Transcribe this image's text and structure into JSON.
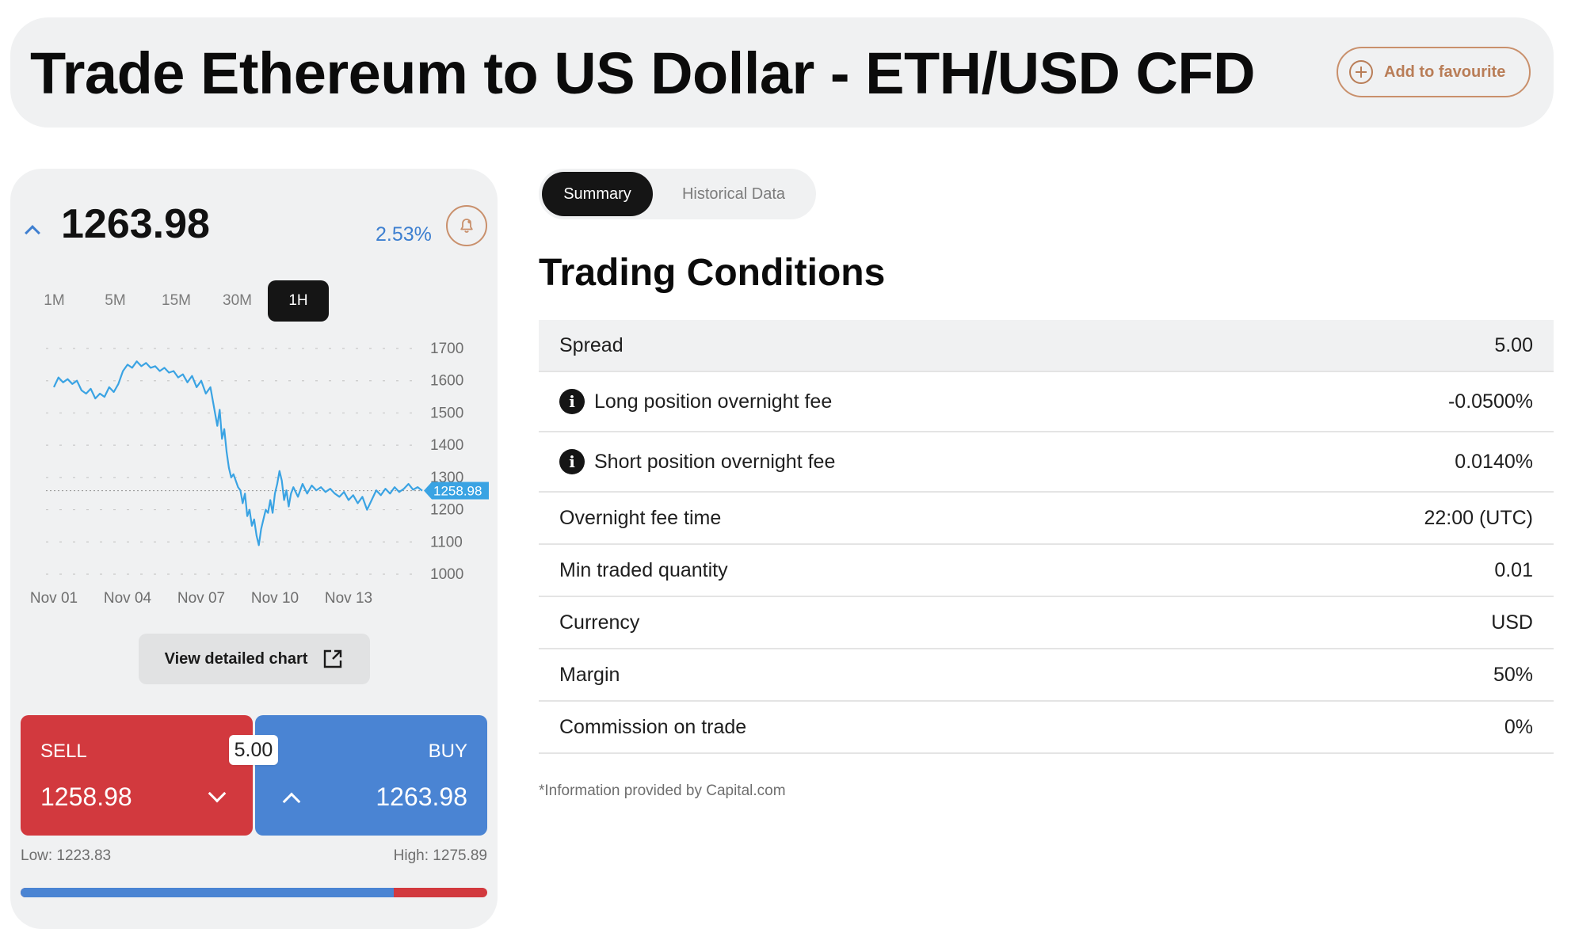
{
  "header": {
    "title": "Trade Ethereum to US Dollar - ETH/USD CFD",
    "favourite_label": "Add to favourite"
  },
  "quote": {
    "price": "1263.98",
    "change_pct": "2.53%",
    "timeframes": [
      "1M",
      "5M",
      "15M",
      "30M",
      "1H"
    ],
    "active_timeframe": "1H"
  },
  "chart_data": {
    "type": "line",
    "x_ticks": [
      "Nov 01",
      "Nov 04",
      "Nov 07",
      "Nov 10",
      "Nov 13"
    ],
    "y_ticks": [
      1700,
      1600,
      1500,
      1400,
      1300,
      1200,
      1100,
      1000
    ],
    "ylim": [
      1000,
      1700
    ],
    "current_marker": "1258.98",
    "grid": true,
    "series": [
      {
        "color": "#3aa3e3",
        "points": [
          [
            0.0,
            1580
          ],
          [
            0.1,
            1610
          ],
          [
            0.2,
            1595
          ],
          [
            0.3,
            1605
          ],
          [
            0.4,
            1590
          ],
          [
            0.5,
            1600
          ],
          [
            0.6,
            1570
          ],
          [
            0.7,
            1560
          ],
          [
            0.8,
            1575
          ],
          [
            0.9,
            1545
          ],
          [
            1.0,
            1560
          ],
          [
            1.1,
            1550
          ],
          [
            1.2,
            1580
          ],
          [
            1.3,
            1565
          ],
          [
            1.4,
            1590
          ],
          [
            1.5,
            1630
          ],
          [
            1.6,
            1650
          ],
          [
            1.7,
            1640
          ],
          [
            1.8,
            1660
          ],
          [
            1.9,
            1645
          ],
          [
            2.0,
            1655
          ],
          [
            2.1,
            1640
          ],
          [
            2.2,
            1645
          ],
          [
            2.3,
            1630
          ],
          [
            2.4,
            1640
          ],
          [
            2.5,
            1625
          ],
          [
            2.6,
            1630
          ],
          [
            2.7,
            1610
          ],
          [
            2.8,
            1620
          ],
          [
            2.9,
            1595
          ],
          [
            3.0,
            1615
          ],
          [
            3.1,
            1580
          ],
          [
            3.2,
            1600
          ],
          [
            3.3,
            1560
          ],
          [
            3.4,
            1580
          ],
          [
            3.5,
            1500
          ],
          [
            3.55,
            1460
          ],
          [
            3.6,
            1510
          ],
          [
            3.65,
            1420
          ],
          [
            3.7,
            1450
          ],
          [
            3.75,
            1380
          ],
          [
            3.8,
            1330
          ],
          [
            3.85,
            1300
          ],
          [
            3.9,
            1310
          ],
          [
            4.0,
            1270
          ],
          [
            4.05,
            1260
          ],
          [
            4.1,
            1220
          ],
          [
            4.15,
            1250
          ],
          [
            4.2,
            1180
          ],
          [
            4.25,
            1200
          ],
          [
            4.3,
            1150
          ],
          [
            4.35,
            1170
          ],
          [
            4.4,
            1120
          ],
          [
            4.45,
            1090
          ],
          [
            4.5,
            1140
          ],
          [
            4.55,
            1170
          ],
          [
            4.6,
            1200
          ],
          [
            4.65,
            1190
          ],
          [
            4.7,
            1230
          ],
          [
            4.75,
            1190
          ],
          [
            4.8,
            1250
          ],
          [
            4.85,
            1280
          ],
          [
            4.9,
            1320
          ],
          [
            4.95,
            1290
          ],
          [
            5.0,
            1230
          ],
          [
            5.05,
            1260
          ],
          [
            5.1,
            1210
          ],
          [
            5.15,
            1250
          ],
          [
            5.2,
            1270
          ],
          [
            5.3,
            1240
          ],
          [
            5.4,
            1280
          ],
          [
            5.5,
            1250
          ],
          [
            5.6,
            1275
          ],
          [
            5.7,
            1260
          ],
          [
            5.8,
            1270
          ],
          [
            5.9,
            1255
          ],
          [
            6.0,
            1265
          ],
          [
            6.1,
            1250
          ],
          [
            6.2,
            1240
          ],
          [
            6.3,
            1255
          ],
          [
            6.4,
            1230
          ],
          [
            6.5,
            1245
          ],
          [
            6.6,
            1220
          ],
          [
            6.7,
            1240
          ],
          [
            6.8,
            1200
          ],
          [
            6.9,
            1230
          ],
          [
            7.0,
            1260
          ],
          [
            7.1,
            1245
          ],
          [
            7.2,
            1265
          ],
          [
            7.3,
            1250
          ],
          [
            7.4,
            1270
          ],
          [
            7.5,
            1255
          ],
          [
            7.6,
            1265
          ],
          [
            7.7,
            1280
          ],
          [
            7.8,
            1262
          ],
          [
            7.9,
            1270
          ],
          [
            8.0,
            1258.98
          ]
        ]
      }
    ]
  },
  "detail_button_label": "View detailed chart",
  "trade": {
    "sell_label": "SELL",
    "sell_price": "1258.98",
    "buy_label": "BUY",
    "buy_price": "1263.98",
    "spread": "5.00",
    "low": "Low: 1223.83",
    "high": "High: 1275.89",
    "range_position": 0.8
  },
  "tabs": {
    "summary": "Summary",
    "historical": "Historical Data"
  },
  "conditions": {
    "title": "Trading Conditions",
    "rows": [
      {
        "name": "Spread",
        "value": "5.00",
        "info": false
      },
      {
        "name": "Long position overnight fee",
        "value": "-0.0500%",
        "info": true
      },
      {
        "name": "Short position overnight fee",
        "value": "0.0140%",
        "info": true
      },
      {
        "name": "Overnight fee time",
        "value": "22:00 (UTC)",
        "info": false
      },
      {
        "name": "Min traded quantity",
        "value": "0.01",
        "info": false
      },
      {
        "name": "Currency",
        "value": "USD",
        "info": false
      },
      {
        "name": "Margin",
        "value": "50%",
        "info": false
      },
      {
        "name": "Commission on trade",
        "value": "0%",
        "info": false
      }
    ],
    "footnote": "*Information provided by Capital.com"
  },
  "colors": {
    "sell": "#d2393e",
    "buy": "#4a84d3",
    "accent": "#c9906c",
    "line": "#3aa3e3"
  }
}
